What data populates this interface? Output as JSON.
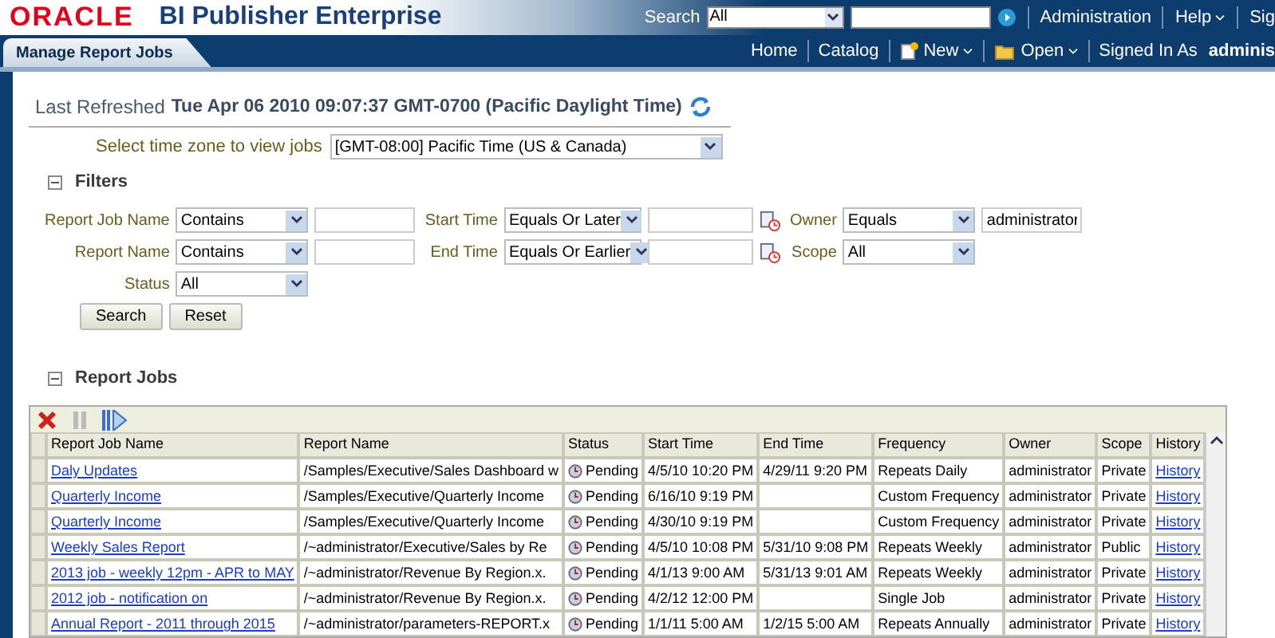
{
  "header": {
    "logo": "ORACLE",
    "product": "BI Publisher Enterprise",
    "search_label": "Search",
    "search_scope": "All",
    "links": [
      {
        "label": "Administration",
        "menu": false
      },
      {
        "label": "Help",
        "menu": true
      },
      {
        "label": "Sig",
        "menu": false
      }
    ]
  },
  "nav": {
    "tab": "Manage Report Jobs",
    "links": [
      {
        "label": "Home",
        "kind": "plain"
      },
      {
        "label": "Catalog",
        "kind": "plain"
      },
      {
        "label": "New",
        "kind": "new"
      },
      {
        "label": "Open",
        "kind": "open"
      }
    ],
    "signed_in_label": "Signed In As",
    "user": "adminis"
  },
  "last_refreshed": {
    "label": "Last Refreshed",
    "value": "Tue Apr 06 2010 09:07:37 GMT-0700 (Pacific Daylight Time)"
  },
  "timezone": {
    "label": "Select time zone to view jobs",
    "value": "[GMT-08:00] Pacific Time (US & Canada)"
  },
  "filters": {
    "title": "Filters",
    "expanded": true,
    "columns": [
      [
        {
          "label": "Report Job Name",
          "operator": "Contains",
          "kind": "text"
        },
        {
          "label": "Report Name",
          "operator": "Contains",
          "kind": "text"
        },
        {
          "label": "Status",
          "operator": "All",
          "kind": "select"
        }
      ],
      [
        {
          "label": "Start Time",
          "operator": "Equals Or Later",
          "kind": "date"
        },
        {
          "label": "End Time",
          "operator": "Equals Or Earlier",
          "kind": "date"
        }
      ],
      [
        {
          "label": "Owner",
          "operator": "Equals",
          "kind": "text",
          "value": "administrator"
        },
        {
          "label": "Scope",
          "operator": "All",
          "kind": "select"
        }
      ]
    ],
    "buttons": [
      "Search",
      "Reset"
    ]
  },
  "report_jobs": {
    "title": "Report Jobs",
    "expanded": true,
    "columns": [
      "Report Job Name",
      "Report Name",
      "Status",
      "Start Time",
      "End Time",
      "Frequency",
      "Owner",
      "Scope",
      "History"
    ],
    "rows": [
      {
        "job": "Daly Updates",
        "report": "/Samples/Executive/Sales Dashboard w",
        "status": "Pending",
        "start": "4/5/10 10:20 PM",
        "end": "4/29/11 9:20 PM",
        "frequency": "Repeats Daily",
        "owner": "administrator",
        "scope": "Private",
        "history": "History"
      },
      {
        "job": "Quarterly Income",
        "report": "/Samples/Executive/Quarterly Income",
        "status": "Pending",
        "start": "6/16/10 9:19 PM",
        "end": "",
        "frequency": "Custom Frequency",
        "owner": "administrator",
        "scope": "Private",
        "history": "History"
      },
      {
        "job": "Quarterly Income",
        "report": "/Samples/Executive/Quarterly Income",
        "status": "Pending",
        "start": "4/30/10 9:19 PM",
        "end": "",
        "frequency": "Custom Frequency",
        "owner": "administrator",
        "scope": "Private",
        "history": "History"
      },
      {
        "job": "Weekly Sales Report",
        "report": "/~administrator/Executive/Sales by Re",
        "status": "Pending",
        "start": "4/5/10 10:08 PM",
        "end": "5/31/10 9:08 PM",
        "frequency": "Repeats Weekly",
        "owner": "administrator",
        "scope": "Public",
        "history": "History"
      },
      {
        "job": "2013 job - weekly 12pm - APR to MAY",
        "report": "/~administrator/Revenue By Region.x.",
        "status": "Pending",
        "start": "4/1/13 9:00 AM",
        "end": "5/31/13 9:01 AM",
        "frequency": "Repeats Weekly",
        "owner": "administrator",
        "scope": "Private",
        "history": "History"
      },
      {
        "job": "2012 job - notification on",
        "report": "/~administrator/Revenue By Region.x.",
        "status": "Pending",
        "start": "4/2/12 12:00 PM",
        "end": "",
        "frequency": "Single Job",
        "owner": "administrator",
        "scope": "Private",
        "history": "History"
      },
      {
        "job": "Annual Report - 2011 through 2015",
        "report": "/~administrator/parameters-REPORT.x",
        "status": "Pending",
        "start": "1/1/11 5:00 AM",
        "end": "1/2/15 5:00 AM",
        "frequency": "Repeats Annually",
        "owner": "administrator",
        "scope": "Private",
        "history": "History"
      }
    ]
  }
}
